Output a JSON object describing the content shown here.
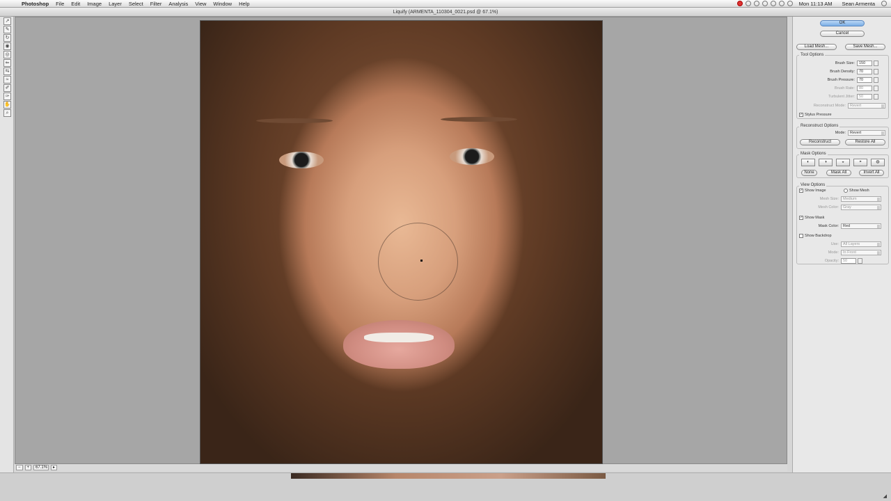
{
  "menubar": {
    "apple_icon": "apple-icon",
    "app_name": "Photoshop",
    "items": [
      "File",
      "Edit",
      "Image",
      "Layer",
      "Select",
      "Filter",
      "Analysis",
      "View",
      "Window",
      "Help"
    ],
    "clock": "Mon 11:13 AM",
    "user": "Sean Armenta"
  },
  "window": {
    "title": "Liquify (ARMENTA_110304_0021.psd @ 67.1%)"
  },
  "statusbar": {
    "zoom": "67.1%"
  },
  "panel": {
    "ok_label": "OK",
    "cancel_label": "Cancel",
    "load_mesh_label": "Load Mesh...",
    "save_mesh_label": "Save Mesh...",
    "tool_options": {
      "title": "Tool Options",
      "brush_size_label": "Brush Size:",
      "brush_size": "150",
      "brush_density_label": "Brush Density:",
      "brush_density": "70",
      "brush_pressure_label": "Brush Pressure:",
      "brush_pressure": "70",
      "brush_rate_label": "Brush Rate:",
      "brush_rate": "80",
      "turbulent_jitter_label": "Turbulent Jitter:",
      "turbulent_jitter": "50",
      "reconstruct_mode_label": "Reconstruct Mode:",
      "reconstruct_mode": "Revert",
      "stylus_pressure_label": "Stylus Pressure"
    },
    "reconstruct_options": {
      "title": "Reconstruct Options",
      "mode_label": "Mode:",
      "mode": "Revert",
      "reconstruct_label": "Reconstruct",
      "restore_all_label": "Restore All"
    },
    "mask_options": {
      "title": "Mask Options",
      "none_label": "None",
      "mask_all_label": "Mask All",
      "invert_all_label": "Invert All"
    },
    "view_options": {
      "title": "View Options",
      "show_image_label": "Show Image",
      "show_mesh_label": "Show Mesh",
      "mesh_size_label": "Mesh Size:",
      "mesh_size": "Medium",
      "mesh_color_label": "Mesh Color:",
      "mesh_color": "Gray",
      "show_mask_label": "Show Mask",
      "mask_color_label": "Mask Color:",
      "mask_color": "Red",
      "show_backdrop_label": "Show Backdrop",
      "use_label": "Use:",
      "use": "All Layers",
      "mode_label": "Mode:",
      "mode": "In Front",
      "opacity_label": "Opacity:",
      "opacity": "50"
    }
  }
}
